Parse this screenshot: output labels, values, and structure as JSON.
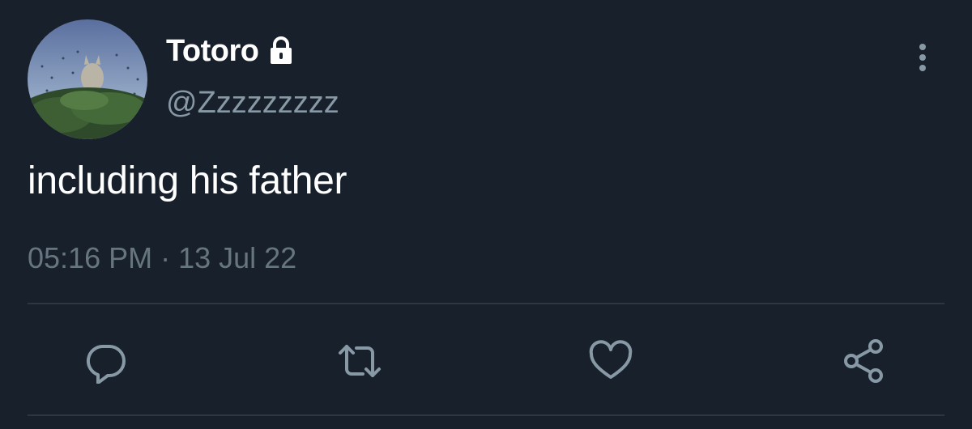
{
  "author": {
    "display_name": "Totoro",
    "handle": "@Zzzzzzzzz",
    "protected_icon": "lock-icon"
  },
  "tweet": {
    "text": "including his father",
    "time": "05:16 PM",
    "separator": "·",
    "date": "13 Jul 22"
  },
  "actions": [
    {
      "name": "reply",
      "icon": "reply-icon"
    },
    {
      "name": "retweet",
      "icon": "retweet-icon"
    },
    {
      "name": "like",
      "icon": "heart-icon"
    },
    {
      "name": "share",
      "icon": "share-icon"
    }
  ],
  "colors": {
    "background": "#17202b",
    "primary_text": "#ffffff",
    "secondary_text": "#8899a6",
    "icon": "#8899a6",
    "divider": "#2c3742"
  }
}
